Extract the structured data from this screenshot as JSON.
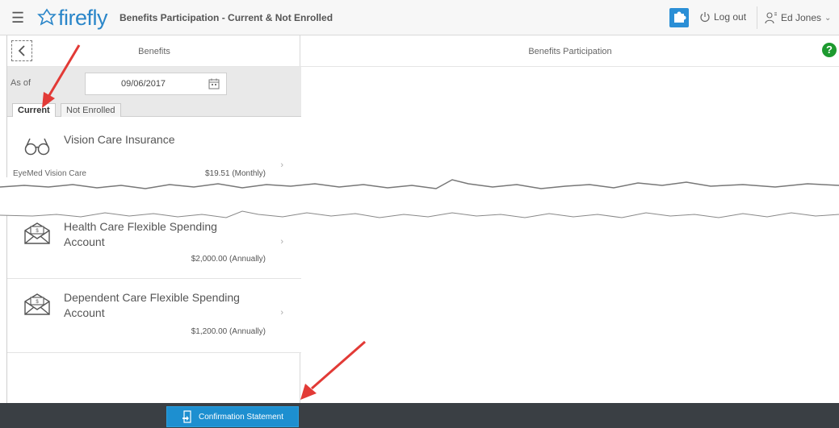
{
  "header": {
    "brand": "firefly",
    "title": "Benefits Participation - Current & Not Enrolled",
    "logout_label": "Log out",
    "user_name": "Ed Jones"
  },
  "left_panel": {
    "title": "Benefits",
    "as_of_label": "As of",
    "as_of_date": "09/06/2017",
    "tabs": [
      {
        "label": "Current",
        "active": true
      },
      {
        "label": "Not Enrolled",
        "active": false
      }
    ],
    "items": [
      {
        "title": "Vision Care Insurance",
        "sub": "EyeMed Vision Care",
        "amount": "$19.51 (Monthly)",
        "icon": "glasses-icon"
      },
      {
        "title": "Health Care Flexible Spending Account",
        "sub": "",
        "amount": "$2,000.00 (Annually)",
        "icon": "money-envelope-icon"
      },
      {
        "title": "Dependent Care Flexible Spending Account",
        "sub": "",
        "amount": "$1,200.00 (Annually)",
        "icon": "money-envelope-icon"
      }
    ]
  },
  "right_panel": {
    "title": "Benefits Participation"
  },
  "footer": {
    "confirm_label": "Confirmation Statement"
  },
  "colors": {
    "accent": "#1d8fd0",
    "help": "#1d9a2f",
    "arrow": "#e23a36",
    "footer": "#3a3f44"
  }
}
